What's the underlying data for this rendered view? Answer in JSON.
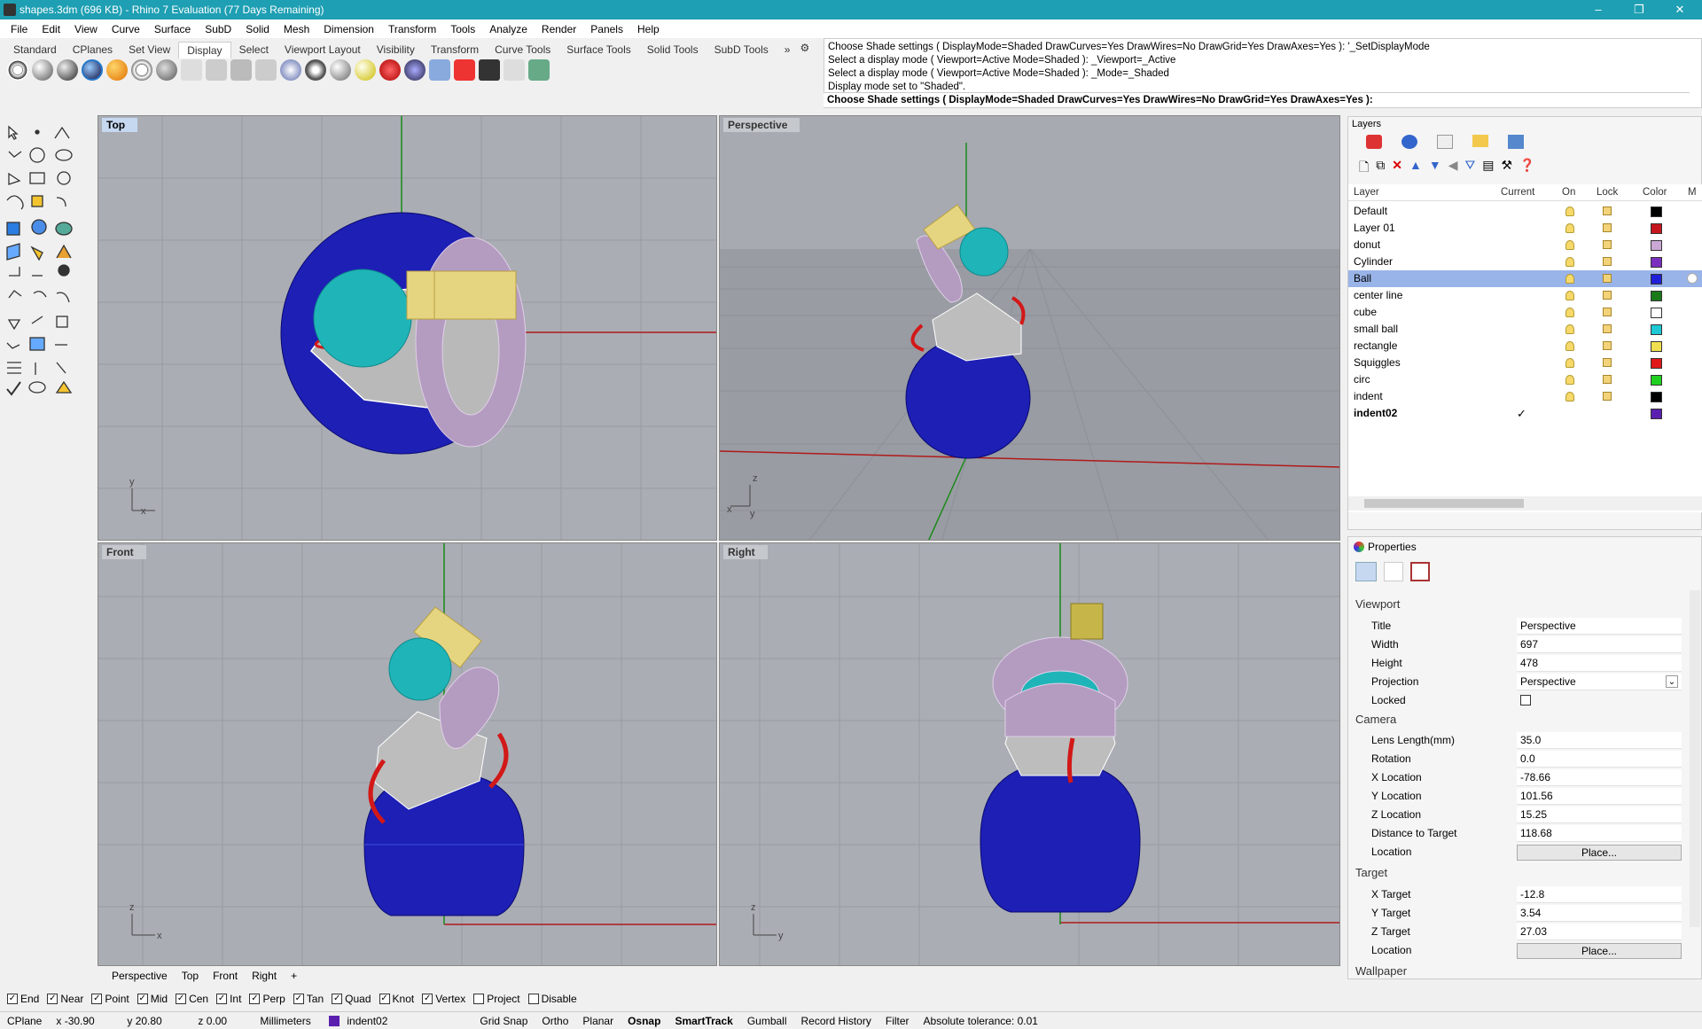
{
  "window": {
    "title": "shapes.3dm (696 KB) - Rhino 7 Evaluation (77 Days Remaining)",
    "minimize": "–",
    "restore": "❐",
    "close": "✕"
  },
  "menu": [
    "File",
    "Edit",
    "View",
    "Curve",
    "Surface",
    "SubD",
    "Solid",
    "Mesh",
    "Dimension",
    "Transform",
    "Tools",
    "Analyze",
    "Render",
    "Panels",
    "Help"
  ],
  "toolbar_tabs": [
    "Standard",
    "CPlanes",
    "Set View",
    "Display",
    "Select",
    "Viewport Layout",
    "Visibility",
    "Transform",
    "Curve Tools",
    "Surface Tools",
    "Solid Tools",
    "SubD Tools"
  ],
  "toolbar_tabs_more": "»",
  "command_history": [
    "Choose Shade settings ( DisplayMode=Shaded  DrawCurves=Yes  DrawWires=No  DrawGrid=Yes  DrawAxes=Yes ): '_SetDisplayMode",
    "Select a display mode ( Viewport=Active  Mode=Shaded ): _Viewport=_Active",
    "Select a display mode ( Viewport=Active  Mode=Shaded ): _Mode=_Shaded",
    "Display mode set to \"Shaded\"."
  ],
  "command_prompt": "Choose Shade settings ( DisplayMode=Shaded  DrawCurves=Yes  DrawWires=No  DrawGrid=Yes  DrawAxes=Yes ):",
  "viewports": {
    "top": "Top",
    "perspective": "Perspective",
    "front": "Front",
    "right": "Right"
  },
  "axis_labels": {
    "x": "x",
    "y": "y",
    "z": "z"
  },
  "viewport_tabs": [
    "Perspective",
    "Top",
    "Front",
    "Right"
  ],
  "viewport_tab_add": "+",
  "osnaps": [
    {
      "label": "End",
      "checked": true
    },
    {
      "label": "Near",
      "checked": true
    },
    {
      "label": "Point",
      "checked": true
    },
    {
      "label": "Mid",
      "checked": true
    },
    {
      "label": "Cen",
      "checked": true
    },
    {
      "label": "Int",
      "checked": true
    },
    {
      "label": "Perp",
      "checked": true
    },
    {
      "label": "Tan",
      "checked": true
    },
    {
      "label": "Quad",
      "checked": true
    },
    {
      "label": "Knot",
      "checked": true
    },
    {
      "label": "Vertex",
      "checked": true
    },
    {
      "label": "Project",
      "checked": false
    },
    {
      "label": "Disable",
      "checked": false
    }
  ],
  "status": {
    "cplane": "CPlane",
    "x": "x -30.90",
    "y": "y 20.80",
    "z": "z 0.00",
    "units": "Millimeters",
    "layer": "indent02",
    "layer_color": "#5b1fb0",
    "toggles": [
      "Grid Snap",
      "Ortho",
      "Planar",
      "Osnap",
      "SmartTrack",
      "Gumball",
      "Record History",
      "Filter"
    ],
    "tolerance": "Absolute tolerance: 0.01"
  },
  "layers_panel": {
    "title": "Layers",
    "columns": [
      "Layer",
      "Current",
      "On",
      "Lock",
      "Color",
      "M"
    ],
    "rows": [
      {
        "name": "Default",
        "color": "#000000",
        "selected": false,
        "current": false
      },
      {
        "name": "Layer 01",
        "color": "#c4161c",
        "selected": false,
        "current": false
      },
      {
        "name": "donut",
        "color": "#c9a8d6",
        "selected": false,
        "current": false
      },
      {
        "name": "Cylinder",
        "color": "#7b2fbe",
        "selected": false,
        "current": false
      },
      {
        "name": "Ball",
        "color": "#1f1fd8",
        "selected": true,
        "current": false
      },
      {
        "name": "center line",
        "color": "#1a7a1a",
        "selected": false,
        "current": false
      },
      {
        "name": "cube",
        "color": "#ffffff",
        "selected": false,
        "current": false
      },
      {
        "name": "small ball",
        "color": "#1ec8d4",
        "selected": false,
        "current": false
      },
      {
        "name": "rectangle",
        "color": "#f0e050",
        "selected": false,
        "current": false
      },
      {
        "name": "Squiggles",
        "color": "#e01818",
        "selected": false,
        "current": false
      },
      {
        "name": "circ",
        "color": "#20d020",
        "selected": false,
        "current": false
      },
      {
        "name": "indent",
        "color": "#000000",
        "selected": false,
        "current": false
      },
      {
        "name": "indent02",
        "color": "#5b1fb0",
        "selected": false,
        "current": true
      }
    ],
    "current_mark": "✓"
  },
  "properties_panel": {
    "title": "Properties",
    "viewport_section": "Viewport",
    "title_label": "Title",
    "title_value": "Perspective",
    "width_label": "Width",
    "width_value": "697",
    "height_label": "Height",
    "height_value": "478",
    "projection_label": "Projection",
    "projection_value": "Perspective",
    "locked_label": "Locked",
    "camera_section": "Camera",
    "lens_label": "Lens Length(mm)",
    "lens_value": "35.0",
    "rotation_label": "Rotation",
    "rotation_value": "0.0",
    "xloc_label": "X Location",
    "xloc_value": "-78.66",
    "yloc_label": "Y Location",
    "yloc_value": "101.56",
    "zloc_label": "Z Location",
    "zloc_value": "15.25",
    "dist_label": "Distance to Target",
    "dist_value": "118.68",
    "location_label": "Location",
    "place_button": "Place...",
    "target_section": "Target",
    "xt_label": "X Target",
    "xt_value": "-12.8",
    "yt_label": "Y Target",
    "yt_value": "3.54",
    "zt_label": "Z Target",
    "zt_value": "27.03",
    "tloc_label": "Location",
    "tplace_button": "Place...",
    "wallpaper_section": "Wallpaper"
  }
}
